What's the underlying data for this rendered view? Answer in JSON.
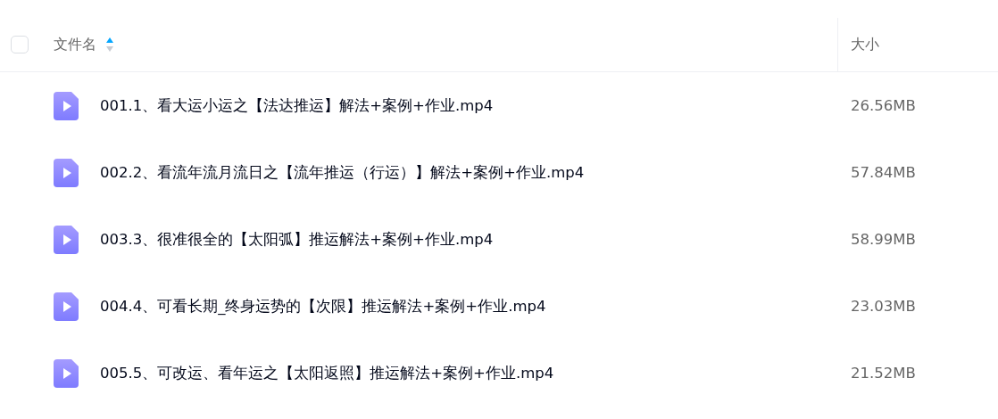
{
  "header": {
    "checked": false,
    "columns": [
      {
        "label": "文件名",
        "sort_ascending": true
      },
      {
        "label": "大小"
      }
    ]
  },
  "rows": [
    {
      "name": "001.1、看大运小运之【法达推运】解法+案例+作业.mp4",
      "size": "26.56MB"
    },
    {
      "name": "002.2、看流年流月流日之【流年推运（行运）】解法+案例+作业.mp4",
      "size": "57.84MB"
    },
    {
      "name": "003.3、很准很全的【太阳弧】推运解法+案例+作业.mp4",
      "size": "58.99MB"
    },
    {
      "name": "004.4、可看长期_终身运势的【次限】推运解法+案例+作业.mp4",
      "size": "23.03MB"
    },
    {
      "name": "005.5、可改运、看年运之【太阳返照】推运解法+案例+作业.mp4",
      "size": "21.52MB"
    }
  ]
}
